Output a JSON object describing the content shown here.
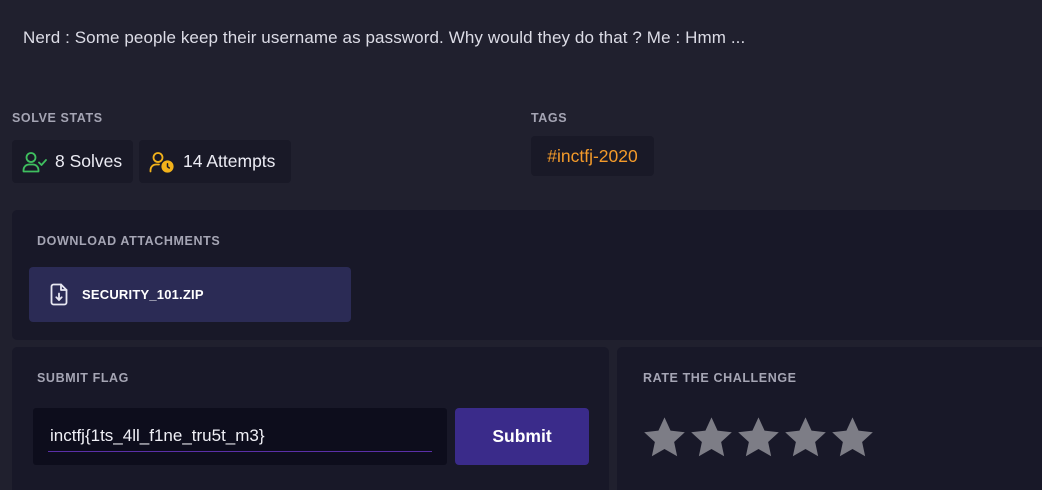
{
  "challenge": {
    "description": "Nerd : Some people keep their username as password. Why would they do that ? Me : Hmm ..."
  },
  "solve_stats": {
    "label": "SOLVE STATS",
    "solves": "8 Solves",
    "attempts": "14 Attempts",
    "solves_icon": "user-check-icon",
    "attempts_icon": "user-clock-icon",
    "solves_color": "#3fbf5f",
    "attempts_color": "#f2b21b"
  },
  "tags": {
    "label": "TAGS",
    "items": [
      "#inctfj-2020"
    ],
    "color": "#f39a2a"
  },
  "attachments": {
    "label": "DOWNLOAD ATTACHMENTS",
    "files": [
      {
        "name": "SECURITY_101.ZIP",
        "icon": "file-download-icon"
      }
    ]
  },
  "submit_flag": {
    "label": "SUBMIT FLAG",
    "value": "inctfj{1ts_4ll_f1ne_tru5t_m3}",
    "button_label": "Submit"
  },
  "rating": {
    "label": "RATE THE CHALLENGE",
    "max": 5,
    "value": 0,
    "star_icon": "star-icon",
    "star_color": "#7d7d86"
  }
}
